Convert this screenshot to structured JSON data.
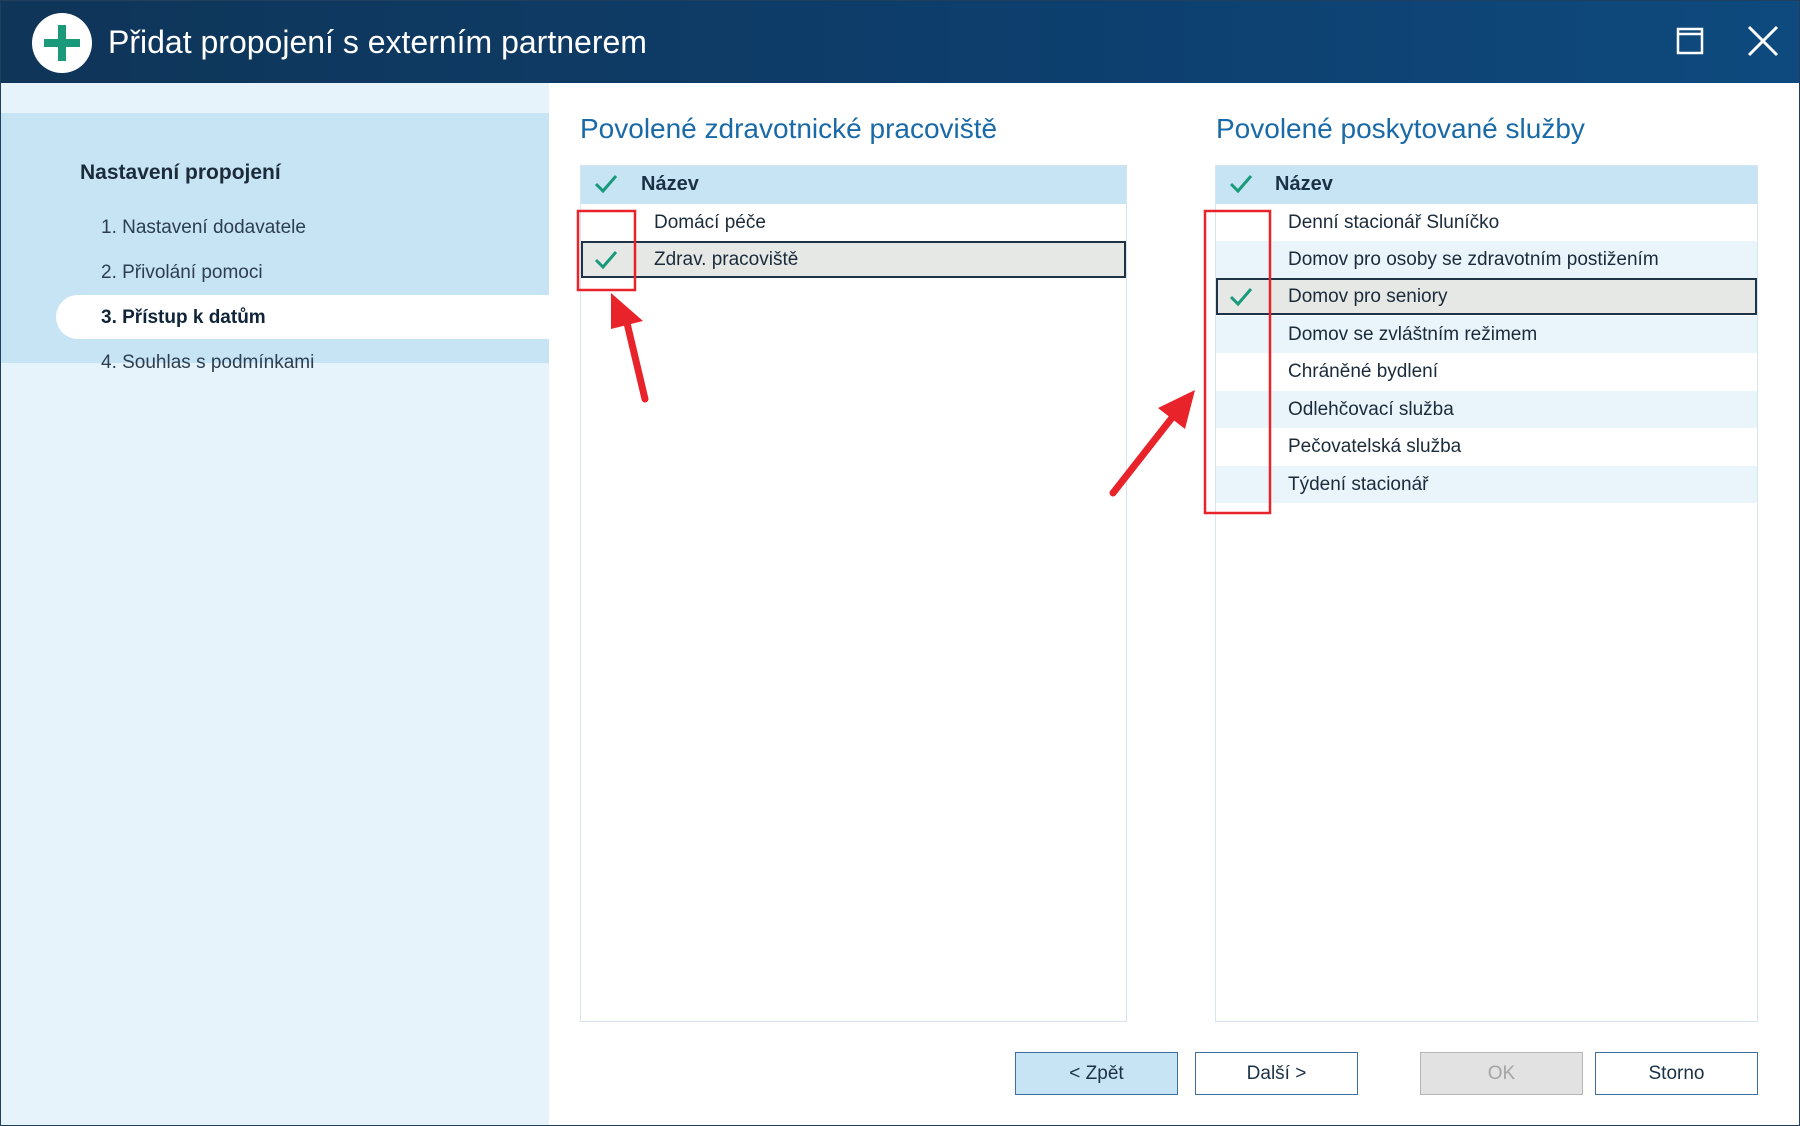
{
  "window": {
    "title": "Přidat propojení s externím partnerem",
    "icon": "plus-circle-icon",
    "maximize_icon": "maximize-icon",
    "close_icon": "close-icon"
  },
  "sidebar": {
    "heading": "Nastavení propojení",
    "items": [
      {
        "label": "1. Nastavení dodavatele",
        "active": false
      },
      {
        "label": "2. Přivolání pomoci",
        "active": false
      },
      {
        "label": "3. Přístup k datům",
        "active": true
      },
      {
        "label": "4. Souhlas s podmínkami",
        "active": false
      }
    ]
  },
  "workplaces": {
    "title": "Povolené zdravotnické pracoviště",
    "column_header": "Název",
    "rows": [
      {
        "label": "Domácí péče",
        "checked": false,
        "selected": false
      },
      {
        "label": "Zdrav. pracoviště",
        "checked": true,
        "selected": true
      }
    ]
  },
  "services": {
    "title": "Povolené poskytované služby",
    "column_header": "Název",
    "rows": [
      {
        "label": "Denní stacionář Sluníčko",
        "checked": false,
        "selected": false
      },
      {
        "label": "Domov pro osoby se zdravotním postižením",
        "checked": false,
        "selected": false
      },
      {
        "label": "Domov pro seniory",
        "checked": true,
        "selected": true
      },
      {
        "label": "Domov se zvláštním režimem",
        "checked": false,
        "selected": false
      },
      {
        "label": "Chráněné bydlení",
        "checked": false,
        "selected": false
      },
      {
        "label": "Odlehčovací služba",
        "checked": false,
        "selected": false
      },
      {
        "label": "Pečovatelská služba",
        "checked": false,
        "selected": false
      },
      {
        "label": "Týdení stacionář",
        "checked": false,
        "selected": false
      }
    ]
  },
  "buttons": {
    "back": "< Zpět",
    "next": "Další >",
    "ok": "OK",
    "cancel": "Storno"
  },
  "colors": {
    "titlebar": "#0f3558",
    "accent": "#1a6aa8",
    "check": "#1a9a7a",
    "annotation": "#e8232a"
  }
}
